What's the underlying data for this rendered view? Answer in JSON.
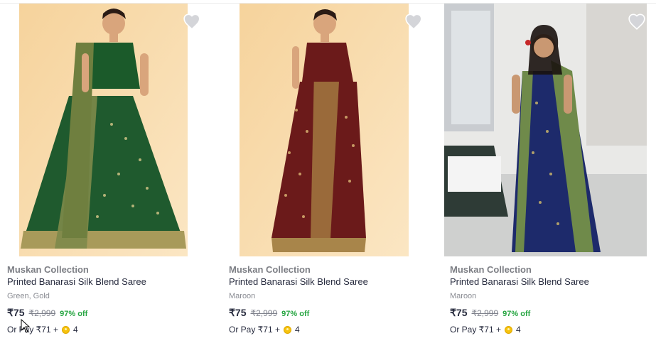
{
  "products": [
    {
      "brand": "Muskan Collection",
      "title": "Printed Banarasi Silk Blend Saree",
      "color": "Green, Gold",
      "price": "₹75",
      "mrp": "₹2,999",
      "discount": "97% off",
      "or_pay_prefix": "Or Pay ₹71 +",
      "coins": "4",
      "wishlist_icon": "heart-icon",
      "coin_icon": "coin-icon"
    },
    {
      "brand": "Muskan Collection",
      "title": "Printed Banarasi Silk Blend Saree",
      "color": "Maroon",
      "price": "₹75",
      "mrp": "₹2,999",
      "discount": "97% off",
      "or_pay_prefix": "Or Pay ₹71 +",
      "coins": "4",
      "wishlist_icon": "heart-icon",
      "coin_icon": "coin-icon"
    },
    {
      "brand": "Muskan Collection",
      "title": "Printed Banarasi Silk Blend Saree",
      "color": "Maroon",
      "price": "₹75",
      "mrp": "₹2,999",
      "discount": "97% off",
      "or_pay_prefix": "Or Pay ₹71 +",
      "coins": "4",
      "wishlist_icon": "heart-icon",
      "coin_icon": "coin-icon"
    }
  ],
  "colors": {
    "discount_green": "#26a541",
    "text_dark": "#282c3f",
    "text_muted": "#7d7f85",
    "coin_yellow": "#f6c30d"
  }
}
